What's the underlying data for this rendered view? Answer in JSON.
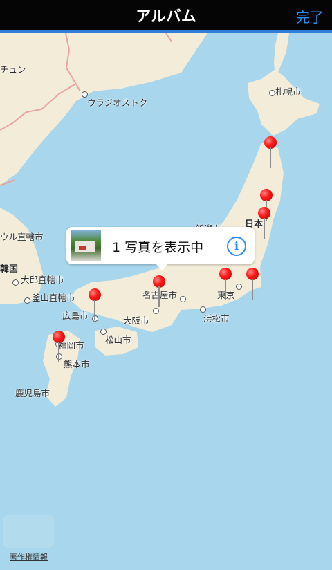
{
  "navbar": {
    "title": "アルバム",
    "done_label": "完了"
  },
  "callout": {
    "text": "1 写真を表示中",
    "info_glyph": "i"
  },
  "labels": {
    "chuen": "チュン",
    "vladivostok": "ウラジオストク",
    "sapporo": "札幌市",
    "niigata": "新潟市",
    "japan": "日本",
    "seoul": "ウル直轄市",
    "korea": "韓国",
    "daegu": "大邱直轄市",
    "busan": "釜山直轄市",
    "hiroshima": "広島市",
    "nagoya": "名古屋市",
    "osaka": "大阪市",
    "tokyo": "東京",
    "hamamatsu": "浜松市",
    "matsuyama": "松山市",
    "fukuoka": "福岡市",
    "kumamoto": "熊本市",
    "kagoshima": "鹿児島市"
  },
  "legal_link": "著作権情報",
  "colors": {
    "sea": "#a8d6ec",
    "land": "#f2ecd9",
    "pin": "#ff1b1b",
    "accent": "#2d8ff5"
  }
}
